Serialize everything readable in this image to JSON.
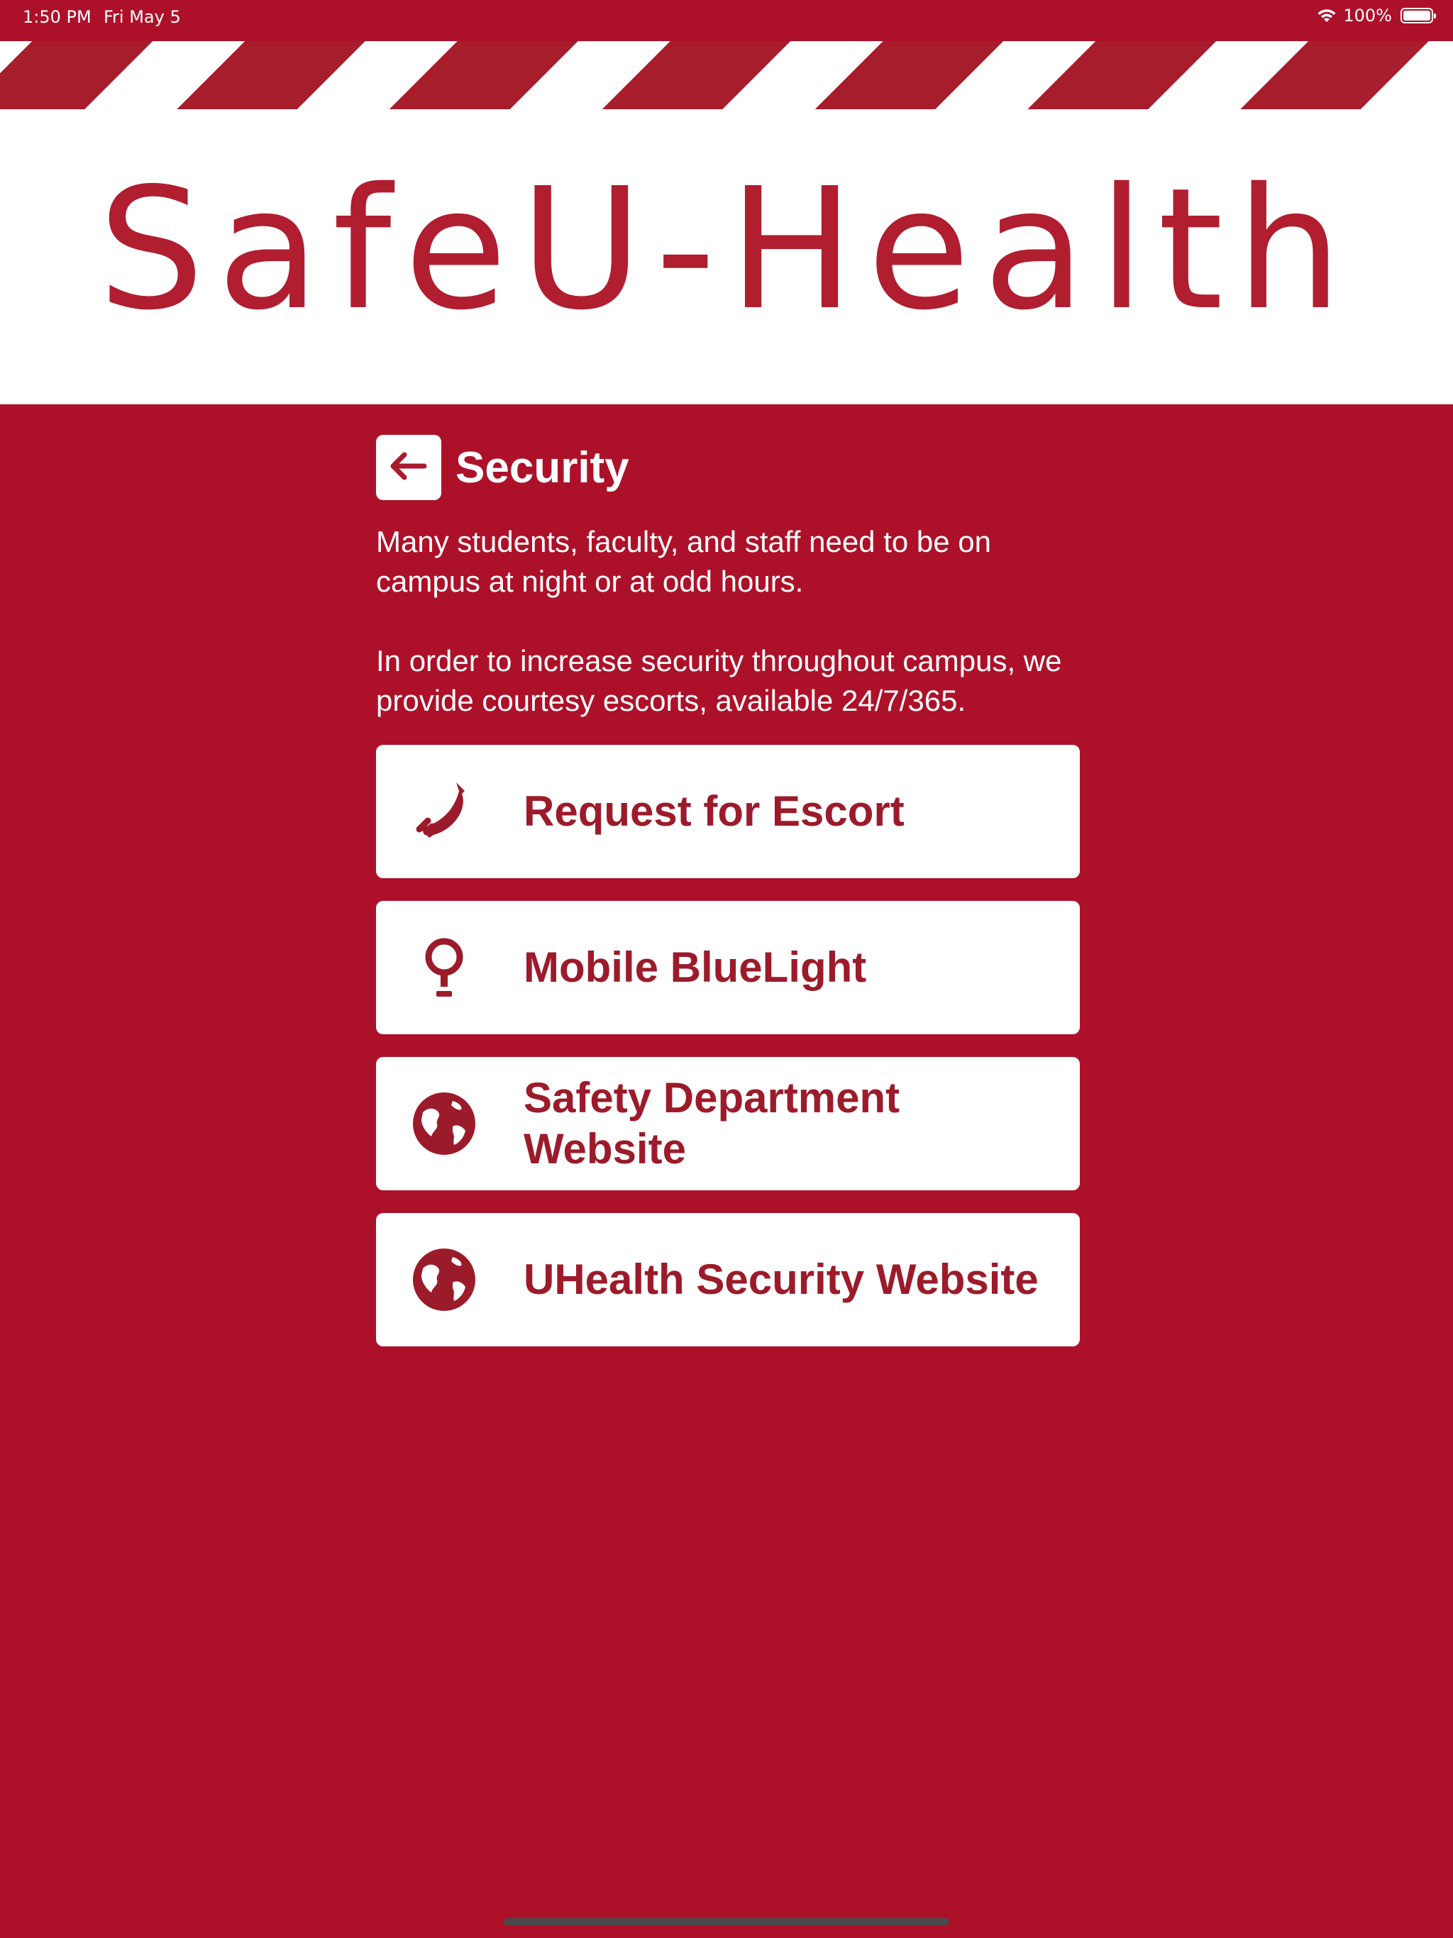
{
  "status_bar": {
    "time": "1:50 PM",
    "date": "Fri May 5",
    "battery": "100%"
  },
  "banner": {
    "logo_text": "SafeU-Health"
  },
  "header": {
    "title": "Security",
    "back_icon": "arrow-left-icon"
  },
  "description": {
    "paragraph_1": "Many students, faculty, and staff need to be on campus at night or at odd hours.",
    "paragraph_2": "In order to increase security throughout campus, we provide courtesy escorts, available 24/7/365."
  },
  "actions": [
    {
      "label": "Request for Escort",
      "icon": "phone-icon"
    },
    {
      "label": "Mobile BlueLight",
      "icon": "lightbulb-icon"
    },
    {
      "label": "Safety Department Website",
      "icon": "globe-icon"
    },
    {
      "label": "UHealth Security Website",
      "icon": "globe-icon"
    }
  ],
  "colors": {
    "background": "#ad1129",
    "accent": "#9c1b2b",
    "surface": "#ffffff"
  }
}
